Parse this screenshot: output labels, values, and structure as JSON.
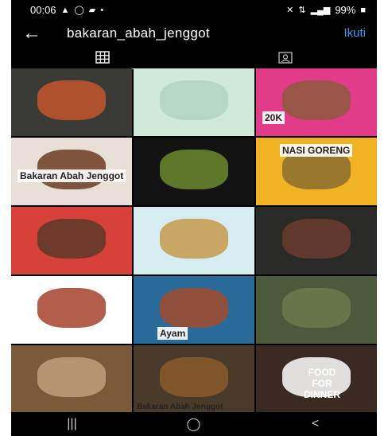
{
  "status": {
    "time": "00:06",
    "battery": "99%"
  },
  "header": {
    "username": "bakaran_abah_jenggot",
    "follow_label": "Ikuti"
  },
  "tabs": [
    {
      "name": "grid"
    },
    {
      "name": "tagged"
    }
  ],
  "posts": [
    {
      "caption": "",
      "bg": "#3a3a36",
      "accent": "#c4562a"
    },
    {
      "caption": "",
      "bg": "#cfe9da",
      "accent": "#b0d4c0"
    },
    {
      "caption": "20K",
      "bg": "#e23b8a",
      "accent": "#8b5a3c"
    },
    {
      "caption": "Bakaran Abah Jenggot",
      "bg": "#e8e0d6",
      "accent": "#6b3b22"
    },
    {
      "caption": "",
      "bg": "#131313",
      "accent": "#6b8b2d"
    },
    {
      "caption": "NASI GORENG",
      "bg": "#f0b324",
      "accent": "#8a6d2f"
    },
    {
      "caption": "",
      "bg": "#d8403a",
      "accent": "#5a3a2a"
    },
    {
      "caption": "",
      "bg": "#d6ecf0",
      "accent": "#c69a4a"
    },
    {
      "caption": "",
      "bg": "#2a2a28",
      "accent": "#6a3b2d"
    },
    {
      "caption": "",
      "bg": "#ffffff",
      "accent": "#a5422a"
    },
    {
      "caption": "Ayam",
      "bg": "#2a6a9a",
      "accent": "#a34a2e"
    },
    {
      "caption": "",
      "bg": "#4a5a3a",
      "accent": "#6c7b4e"
    },
    {
      "caption": "",
      "bg": "#7a5a3a",
      "accent": "#c0a07a"
    },
    {
      "caption": "Bakaran Abah Jenggot",
      "bg": "#4a3a2a",
      "accent": "#8a5a2a"
    },
    {
      "caption": "FOOD FOR DINNER",
      "bg": "#3a2a22",
      "accent": "#ffffff"
    }
  ],
  "nav": {
    "recents": "recents-icon",
    "home": "home-icon",
    "back": "back-icon"
  }
}
